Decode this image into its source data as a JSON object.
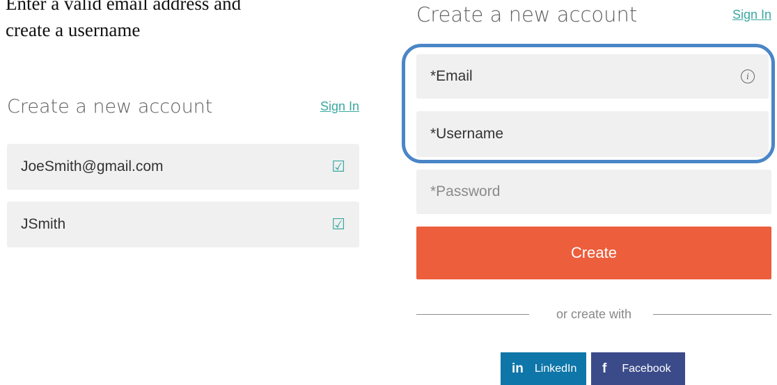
{
  "instruction": {
    "line1": "Enter a valid email address and",
    "line2": "create a username"
  },
  "left_form": {
    "title": "Create a new account",
    "signin_label": "Sign In",
    "email_value": "JoeSmith@gmail.com",
    "username_value": "JSmith",
    "check_glyph": "☑"
  },
  "right_form": {
    "title": "Create a new account",
    "signin_label": "Sign In",
    "email_placeholder": "*Email",
    "username_placeholder": "*Username",
    "password_placeholder": "*Password",
    "info_glyph": "i",
    "create_label": "Create",
    "divider_text": "or create with",
    "linkedin_glyph": "in",
    "linkedin_label": "LinkedIn",
    "facebook_glyph": "f",
    "facebook_label": "Facebook"
  },
  "colors": {
    "accent_teal": "#3aa8a0",
    "create_button": "#ec5e3c",
    "highlight": "#4a86c7",
    "linkedin": "#0e76a8",
    "facebook": "#3b4b8a",
    "field_bg": "#f0f0f0"
  },
  "icons": [
    "check-icon",
    "info-icon",
    "linkedin-icon",
    "facebook-icon"
  ]
}
